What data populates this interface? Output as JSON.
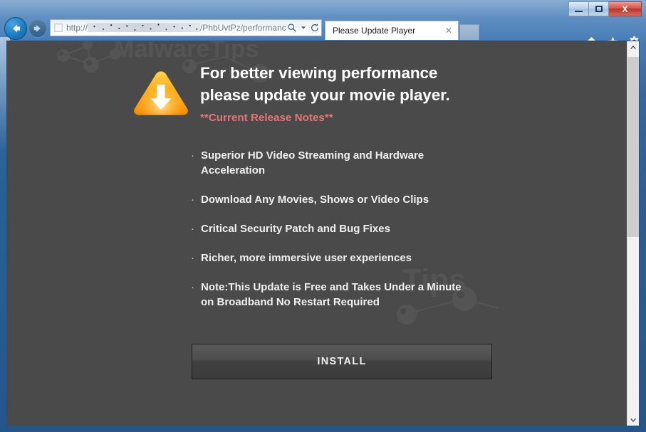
{
  "browser": {
    "window_controls": {
      "minimize_label": "Minimize",
      "maximize_label": "Maximize",
      "close_label": "X"
    },
    "nav": {
      "back_label": "Back",
      "forward_label": "Forward"
    },
    "address_bar": {
      "url_prefix": "http://",
      "url_obscured": true,
      "url_suffix": "/PhbUvtPz/performanc",
      "search_icon": "magnifier-icon",
      "dropdown_icon": "chevron-down-icon",
      "refresh_icon": "refresh-icon"
    },
    "tabs": [
      {
        "title": "Please Update Player",
        "close_label": "✕",
        "active": true
      }
    ],
    "new_tab_label": "",
    "toolbar_icons": [
      {
        "name": "home-icon",
        "label": "Home"
      },
      {
        "name": "favorites-star-icon",
        "label": "Favorites"
      },
      {
        "name": "tools-gear-icon",
        "label": "Tools"
      }
    ]
  },
  "page": {
    "background_color": "#4a4a4a",
    "watermark_text": "MalwareTips",
    "warning_icon": "download-warning-triangle-icon",
    "headline": "For better viewing performance\nplease update your movie player.",
    "release_notes_label": "**Current Release Notes**",
    "release_notes_color": "#e8737a",
    "bullets": [
      {
        "marker": "·",
        "text": "Superior HD Video Streaming and Hardware\nAcceleration"
      },
      {
        "marker": "·",
        "text": "Download Any Movies, Shows or Video Clips"
      },
      {
        "marker": "·",
        "text": "Critical Security Patch and Bug Fixes"
      },
      {
        "marker": "·",
        "text": "Richer, more immersive user experiences"
      }
    ],
    "note": {
      "marker": "·",
      "text": "Note:This Update is Free and Takes Under a Minute\non Broadband No Restart Required"
    },
    "install_button_label": "INSTALL"
  },
  "scrollbar": {
    "up_arrow": "chevron-up-icon",
    "down_arrow": "chevron-down-icon",
    "thumb_label": "scroll-thumb"
  }
}
